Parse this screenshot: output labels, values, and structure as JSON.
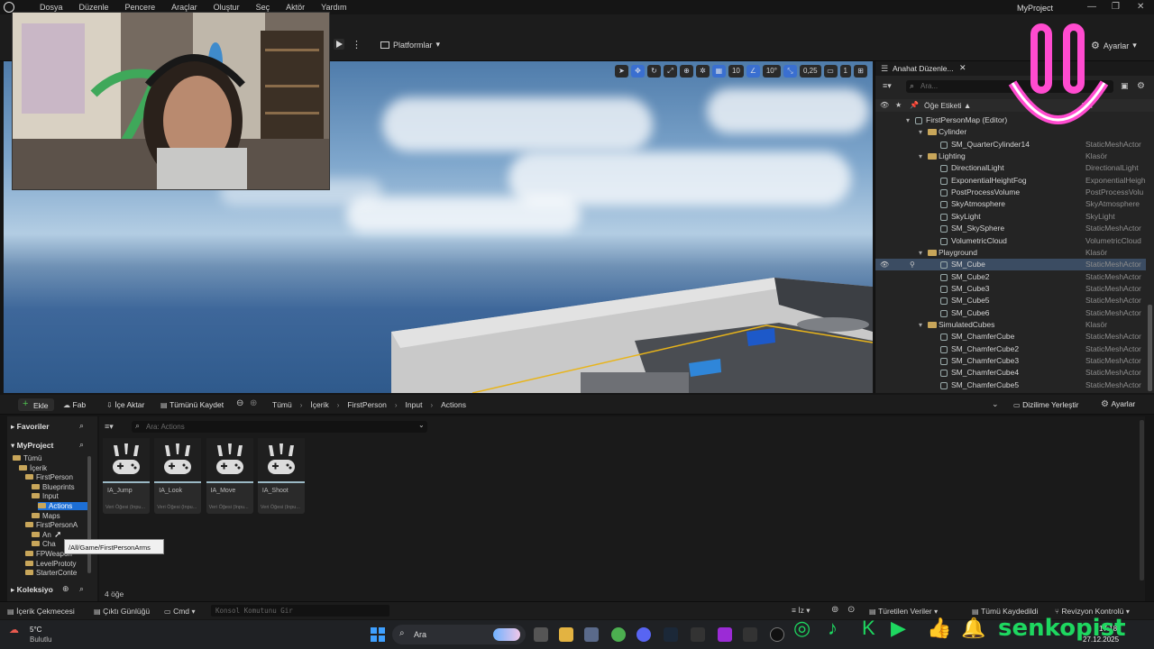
{
  "menubar": {
    "items": [
      "Dosya",
      "Düzenle",
      "Pencere",
      "Araçlar",
      "Oluştur",
      "Seç",
      "Aktör",
      "Yardım"
    ],
    "project_title": "MyProject"
  },
  "toolbar": {
    "platforms_label": "Platformlar",
    "settings_label": "Ayarlar"
  },
  "viewport": {
    "grid_size": "10",
    "rotation_snap": "10°",
    "scale_snap": "0,25",
    "camera_speed": "1"
  },
  "outliner": {
    "tab_title": "Anahat Düzenle...",
    "search_placeholder": "Ara...",
    "col_label": "Öğe Etiketi ▲",
    "col_type": "Tür",
    "rows": [
      {
        "name": "FirstPersonMap (Editor)",
        "type": "",
        "indent": 0,
        "kind": "map"
      },
      {
        "name": "Cylinder",
        "type": "",
        "indent": 1,
        "kind": "folder"
      },
      {
        "name": "SM_QuarterCylinder14",
        "type": "StaticMeshActor",
        "indent": 2,
        "kind": "actor"
      },
      {
        "name": "Lighting",
        "type": "Klasör",
        "indent": 1,
        "kind": "folder"
      },
      {
        "name": "DirectionalLight",
        "type": "DirectionalLight",
        "indent": 2,
        "kind": "actor"
      },
      {
        "name": "ExponentialHeightFog",
        "type": "ExponentialHeigh",
        "indent": 2,
        "kind": "actor"
      },
      {
        "name": "PostProcessVolume",
        "type": "PostProcessVolu",
        "indent": 2,
        "kind": "actor"
      },
      {
        "name": "SkyAtmosphere",
        "type": "SkyAtmosphere",
        "indent": 2,
        "kind": "actor"
      },
      {
        "name": "SkyLight",
        "type": "SkyLight",
        "indent": 2,
        "kind": "actor"
      },
      {
        "name": "SM_SkySphere",
        "type": "StaticMeshActor",
        "indent": 2,
        "kind": "actor"
      },
      {
        "name": "VolumetricCloud",
        "type": "VolumetricCloud",
        "indent": 2,
        "kind": "actor"
      },
      {
        "name": "Playground",
        "type": "Klasör",
        "indent": 1,
        "kind": "folder"
      },
      {
        "name": "SM_Cube",
        "type": "StaticMeshActor",
        "indent": 2,
        "kind": "actor",
        "selected": true
      },
      {
        "name": "SM_Cube2",
        "type": "StaticMeshActor",
        "indent": 2,
        "kind": "actor"
      },
      {
        "name": "SM_Cube3",
        "type": "StaticMeshActor",
        "indent": 2,
        "kind": "actor"
      },
      {
        "name": "SM_Cube5",
        "type": "StaticMeshActor",
        "indent": 2,
        "kind": "actor"
      },
      {
        "name": "SM_Cube6",
        "type": "StaticMeshActor",
        "indent": 2,
        "kind": "actor"
      },
      {
        "name": "SimulatedCubes",
        "type": "Klasör",
        "indent": 1,
        "kind": "folder"
      },
      {
        "name": "SM_ChamferCube",
        "type": "StaticMeshActor",
        "indent": 2,
        "kind": "actor"
      },
      {
        "name": "SM_ChamferCube2",
        "type": "StaticMeshActor",
        "indent": 2,
        "kind": "actor"
      },
      {
        "name": "SM_ChamferCube3",
        "type": "StaticMeshActor",
        "indent": 2,
        "kind": "actor"
      },
      {
        "name": "SM_ChamferCube4",
        "type": "StaticMeshActor",
        "indent": 2,
        "kind": "actor"
      },
      {
        "name": "SM_ChamferCube5",
        "type": "StaticMeshActor",
        "indent": 2,
        "kind": "actor"
      },
      {
        "name": "SM_ChamferCube6",
        "type": "StaticMeshActor",
        "indent": 2,
        "kind": "actor"
      }
    ]
  },
  "content_browser": {
    "add_label": "Ekle",
    "fab_label": "Fab",
    "import_label": "İçe Aktar",
    "save_all_label": "Tümünü Kaydet",
    "breadcrumbs": [
      "Tümü",
      "İçerik",
      "FirstPerson",
      "Input",
      "Actions"
    ],
    "dock_label": "Dizilime Yerleştir",
    "settings_label": "Ayarlar",
    "favorites_label": "Favoriler",
    "project_label": "MyProject",
    "search_placeholder": "Ara: Actions",
    "collections_label": "Koleksiyo",
    "item_count": "4 öğe",
    "tooltip": "/All/Game/FirstPersonArms",
    "tree": [
      {
        "label": "Tümü",
        "indent": 0
      },
      {
        "label": "İçerik",
        "indent": 1
      },
      {
        "label": "FirstPerson",
        "indent": 2
      },
      {
        "label": "Blueprints",
        "indent": 3
      },
      {
        "label": "Input",
        "indent": 3
      },
      {
        "label": "Actions",
        "indent": 4,
        "selected": true
      },
      {
        "label": "Maps",
        "indent": 3
      },
      {
        "label": "FirstPersonA",
        "indent": 2
      },
      {
        "label": "An",
        "indent": 3
      },
      {
        "label": "Cha",
        "indent": 3
      },
      {
        "label": "FPWeapon",
        "indent": 2
      },
      {
        "label": "LevelPrototy",
        "indent": 2
      },
      {
        "label": "StarterConte",
        "indent": 2
      }
    ],
    "assets": [
      {
        "name": "IA_Jump",
        "sub": "Veri Öğesi (Inpu..."
      },
      {
        "name": "IA_Look",
        "sub": "Veri Öğesi (Inpu..."
      },
      {
        "name": "IA_Move",
        "sub": "Veri Öğesi (Inpu..."
      },
      {
        "name": "IA_Shoot",
        "sub": "Veri Öğesi (Inpu..."
      }
    ]
  },
  "statusbar": {
    "content_drawer": "İçerik Çekmecesi",
    "output_log": "Çıktı Günlüğü",
    "cmd_label": "Cmd",
    "console_placeholder": "Konsol Komutunu Gir",
    "derived_data": "Türetilen Veriler",
    "all_saved": "Tümü Kaydedildi",
    "revision_control": "Revizyon Kontrolü"
  },
  "taskbar": {
    "weather_temp": "5°C",
    "weather_desc": "Bulutlu",
    "search_label": "Ara",
    "time": "17:18",
    "date": "27.12.2025"
  },
  "overlay": {
    "channel_name": "senkopist"
  }
}
